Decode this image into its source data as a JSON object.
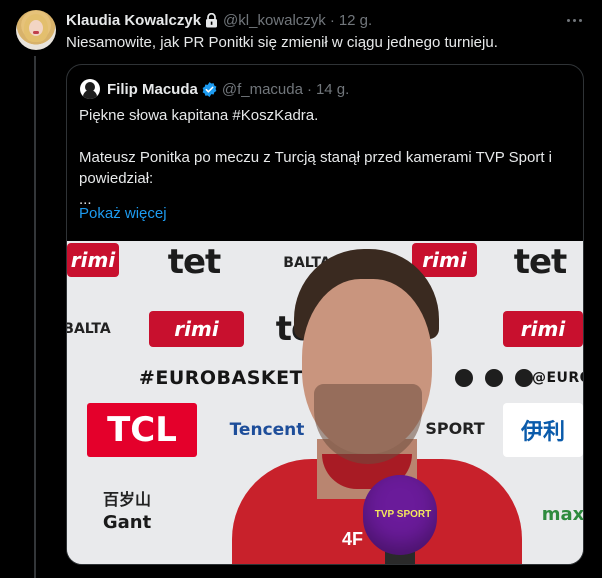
{
  "tweet": {
    "author_name": "Klaudia Kowalczyk",
    "handle": "@kl_kowalczyk",
    "separator": "·",
    "time": "12 g.",
    "text": "Niesamowite, jak PR Ponitki się zmienił w ciągu jednego turnieju.",
    "icons": {
      "protected": "lock-icon",
      "more": "more-icon"
    }
  },
  "quote": {
    "author_name": "Filip Macuda",
    "handle": "@f_macuda",
    "separator": "·",
    "time": "14 g.",
    "lines": [
      "Piękne słowa kapitana #KoszKadra.",
      "",
      "Mateusz Ponitka po meczu z Turcją stanął przed kamerami TVP Sport i powiedział:",
      "..."
    ],
    "show_more": "Pokaż więcej",
    "verified_icon": "verified-badge-icon"
  },
  "media": {
    "wall": {
      "rimi": "rimi",
      "tet": "tet",
      "balta": "BALTA",
      "eurobasket": "#EUROBASKET",
      "euro_short": "@EURO",
      "tcl": "TCL",
      "tencent": "Tencent",
      "sport": "SPORT",
      "yili": "伊利",
      "baisuishan": "百岁山",
      "gant": "Gant",
      "max": "max"
    },
    "jersey_logo": "4F",
    "mic_label": "TVP SPORT"
  },
  "colors": {
    "background": "#000000",
    "text": "#e7e9ea",
    "muted": "#71767b",
    "link": "#1d9bf0",
    "border": "#2f3336",
    "verified": "#1d9bf0"
  }
}
